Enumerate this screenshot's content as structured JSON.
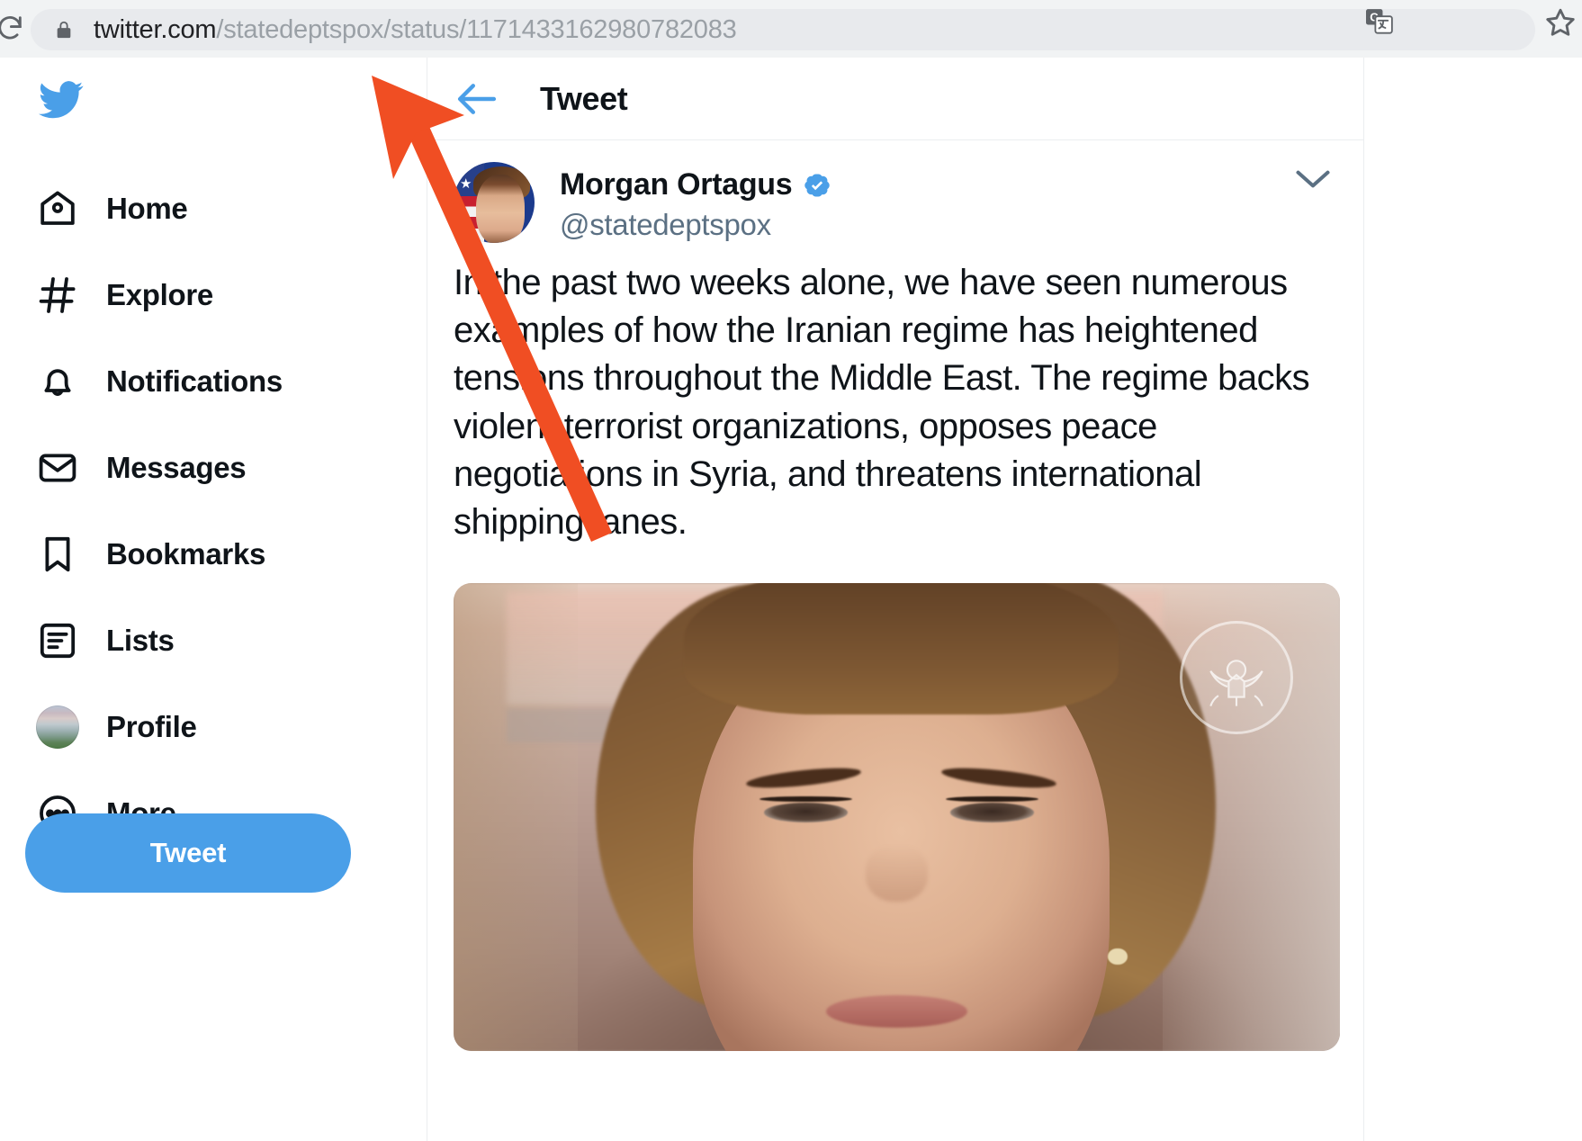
{
  "browser": {
    "url_domain": "twitter.com",
    "url_path": "/statedeptspox/status/1171433162980782083",
    "lock_icon": "lock-icon",
    "reload_icon": "reload-icon",
    "translate_icon": "google-translate-icon",
    "bookmark_icon": "bookmark-star-icon",
    "chrome_bg": "#F1F3F4",
    "omnibox_bg": "#E8EAED"
  },
  "sidebar": {
    "logo_icon": "twitter-bird-logo",
    "accent_color": "#4A9FE8",
    "items": [
      {
        "label": "Home",
        "icon": "home-icon"
      },
      {
        "label": "Explore",
        "icon": "hashtag-icon"
      },
      {
        "label": "Notifications",
        "icon": "bell-icon"
      },
      {
        "label": "Messages",
        "icon": "envelope-icon"
      },
      {
        "label": "Bookmarks",
        "icon": "bookmark-icon"
      },
      {
        "label": "Lists",
        "icon": "list-icon"
      },
      {
        "label": "Profile",
        "icon": "avatar-thumbnail"
      },
      {
        "label": "More",
        "icon": "more-circle-icon"
      }
    ],
    "compose_button": "Tweet"
  },
  "main": {
    "header": {
      "title": "Tweet",
      "back_icon": "back-arrow-icon"
    },
    "tweet": {
      "display_name": "Morgan Ortagus",
      "handle": "@statedeptspox",
      "verified": true,
      "verified_icon": "verified-badge-icon",
      "avatar": "profile-photo",
      "menu_icon": "chevron-down-icon",
      "text": "In the past two weeks alone, we have seen numerous examples of how the Iranian regime has heightened tensions throughout the Middle East. The regime backs violent terrorist organizations, opposes peace negotiations in Syria, and threatens international shipping lanes.",
      "media": {
        "type": "video-thumbnail",
        "watermark_icon": "state-department-seal"
      }
    }
  },
  "annotation": {
    "arrow_color": "#F04E23",
    "arrow_name": "orange-pointer-arrow"
  }
}
